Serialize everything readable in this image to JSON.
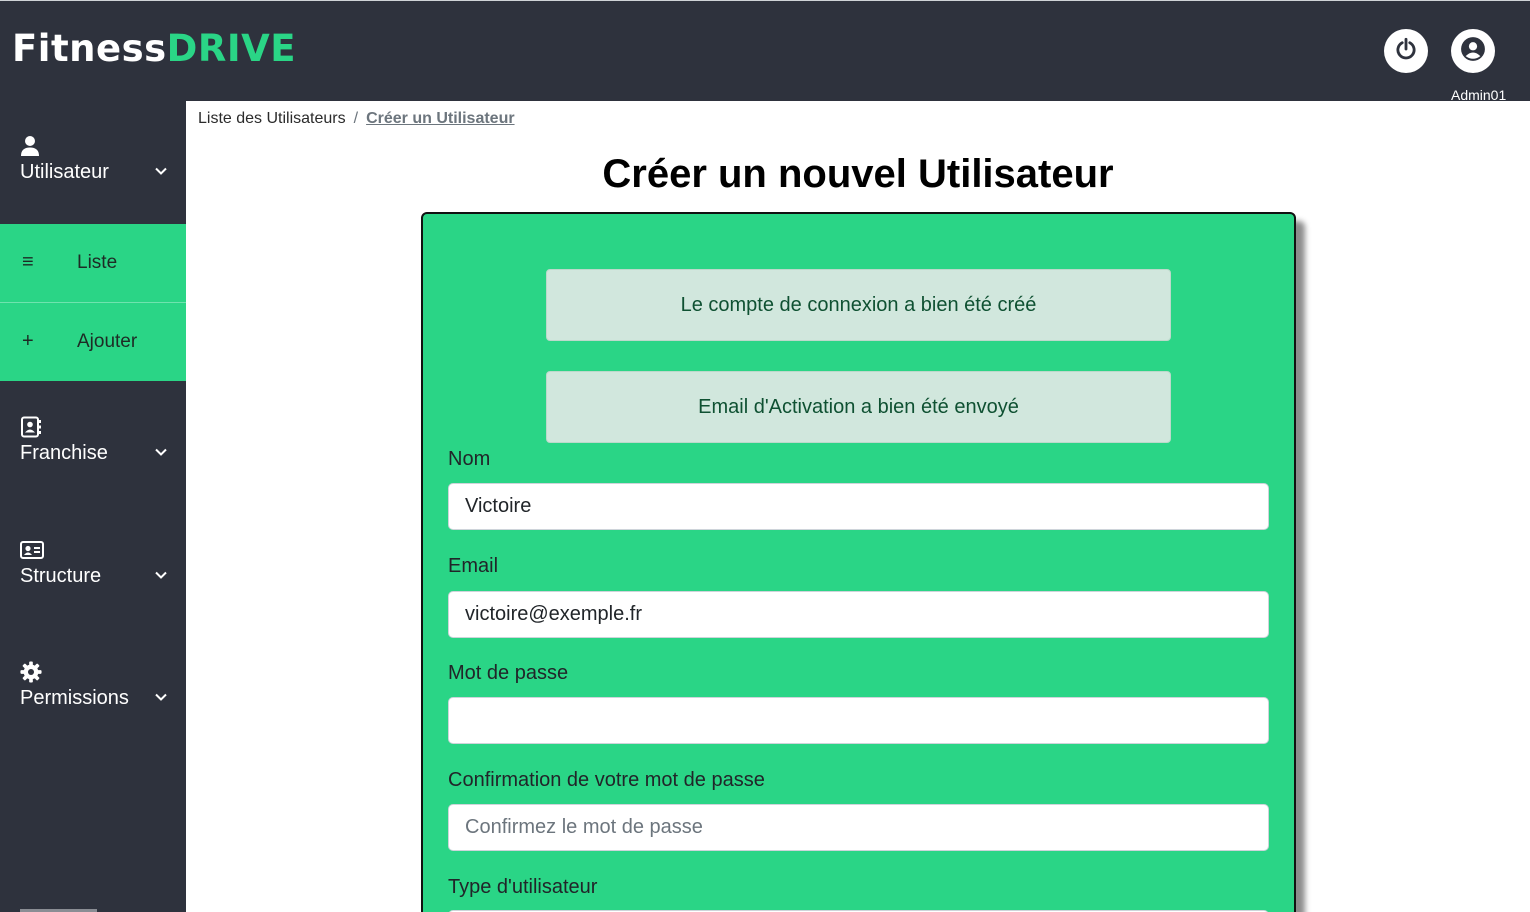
{
  "header": {
    "logo_part1": "Fitness",
    "logo_part2": "DRIVE",
    "username": "Admin01",
    "icons": {
      "logout": "power-icon",
      "account": "user-circle-icon"
    }
  },
  "sidebar": {
    "groups": [
      {
        "label": "Utilisateur",
        "icon": "user-icon"
      },
      {
        "label": "Franchise",
        "icon": "address-book-icon"
      },
      {
        "label": "Structure",
        "icon": "id-card-icon"
      },
      {
        "label": "Permissions",
        "icon": "gear-icon"
      }
    ],
    "subitems": [
      {
        "icon_glyph": "≡",
        "label": "Liste"
      },
      {
        "icon_glyph": "+",
        "label": "Ajouter"
      }
    ]
  },
  "breadcrumb": {
    "items": [
      "Liste des Utilisateurs",
      "Créer un Utilisateur"
    ],
    "separator": "/"
  },
  "page": {
    "title": "Créer un nouvel Utilisateur"
  },
  "alerts": [
    "Le compte de connexion a bien été créé",
    "Email d'Activation a bien été envoyé"
  ],
  "form": {
    "nom": {
      "label": "Nom",
      "value": "Victoire",
      "placeholder": ""
    },
    "email": {
      "label": "Email",
      "value": "victoire@exemple.fr",
      "placeholder": ""
    },
    "password": {
      "label": "Mot de passe",
      "value": "",
      "placeholder": ""
    },
    "password_confirm": {
      "label": "Confirmation de votre mot de passe",
      "value": "",
      "placeholder": "Confirmez le mot de passe"
    },
    "user_type": {
      "label": "Type d'utilisateur"
    }
  },
  "colors": {
    "brand_green": "#2ad586",
    "dark_bg": "#2e323d",
    "alert_bg": "#d1e7dd",
    "alert_text": "#0f5132"
  }
}
